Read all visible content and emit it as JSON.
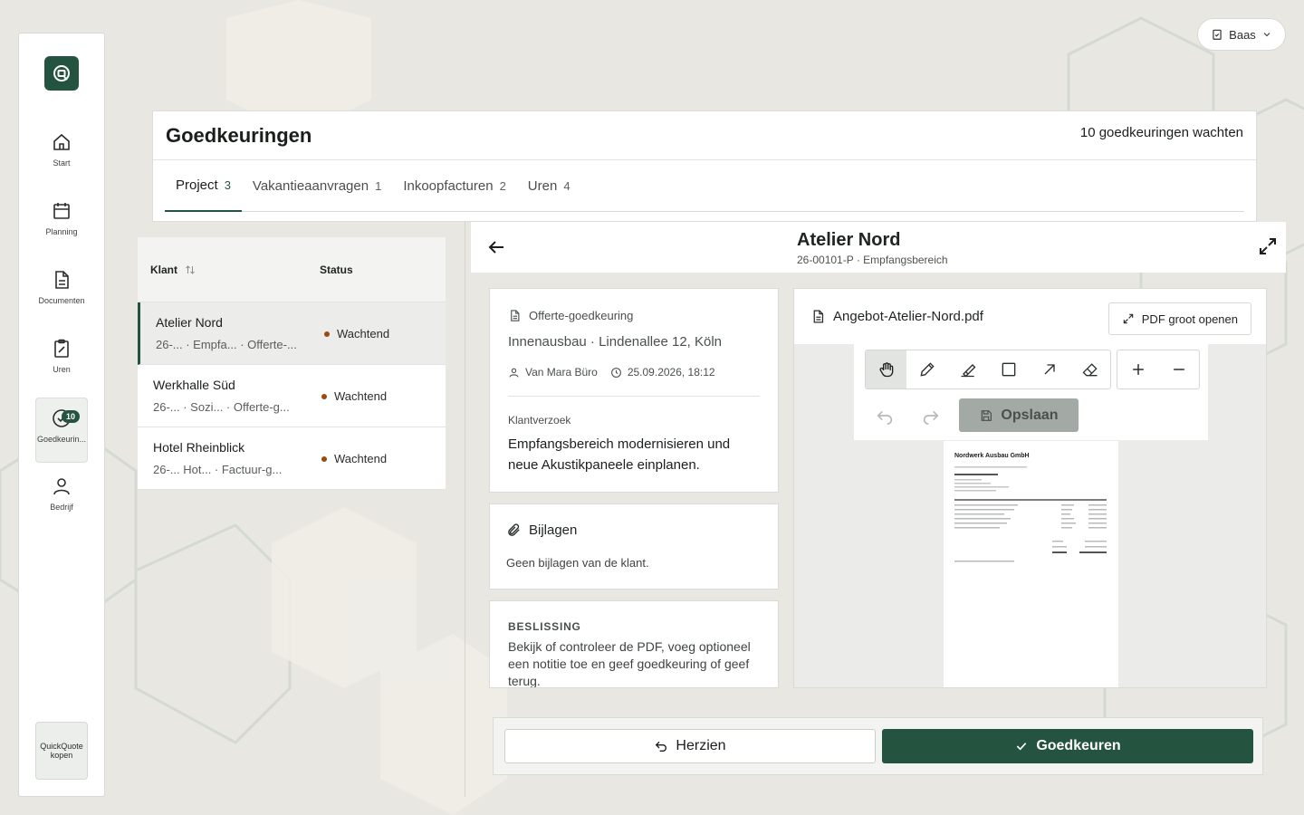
{
  "sidebar": {
    "items": [
      {
        "label": "Start"
      },
      {
        "label": "Planning"
      },
      {
        "label": "Documenten"
      },
      {
        "label": "Uren"
      },
      {
        "label": "Goedkeurin...",
        "badge": "10"
      },
      {
        "label": "Bedrijf"
      }
    ],
    "buy_label": "QuickQuote kopen"
  },
  "role": {
    "label": "Baas"
  },
  "header": {
    "title": "Goedkeuringen",
    "count": "10 goedkeuringen wachten",
    "tabs": [
      {
        "label": "Project",
        "count": "3"
      },
      {
        "label": "Vakantieaanvragen",
        "count": "1"
      },
      {
        "label": "Inkoopfacturen",
        "count": "2"
      },
      {
        "label": "Uren",
        "count": "4"
      }
    ]
  },
  "list": {
    "col_klant": "Klant",
    "col_status": "Status",
    "rows": [
      {
        "name": "Atelier Nord",
        "meta": "26-... · Empfa... · Offerte-...",
        "status": "Wachtend"
      },
      {
        "name": "Werkhalle Süd",
        "meta": "26-...  · Sozi... · Offerte-g...",
        "status": "Wachtend"
      },
      {
        "name": "Hotel Rheinblick",
        "meta": "26-...  Hot...  · Factuur-g...",
        "status": "Wachtend"
      }
    ]
  },
  "detail": {
    "name": "Atelier Nord",
    "sub": "26-00101-P · Empfangsbereich",
    "request": {
      "type": "Offerte-goedkeuring",
      "title": "Innenausbau · Lindenallee 12, Köln",
      "author": "Van Mara Büro",
      "datetime": "25.09.2026, 18:12",
      "label": "Klantverzoek",
      "text": "Empfangsbereich modernisieren und neue Akustikpaneele einplanen."
    },
    "attachments": {
      "title": "Bijlagen",
      "text": "Geen bijlagen van de klant."
    },
    "decision": {
      "label": "BESLISSING",
      "text": "Bekijk of controleer de PDF, voeg optioneel een notitie toe en geef goedkeuring of geef terug."
    }
  },
  "pdf": {
    "filename": "Angebot-Atelier-Nord.pdf",
    "open_label": "PDF groot openen",
    "save_label": "Opslaan",
    "page_title": "Nordwerk Ausbau GmbH"
  },
  "actions": {
    "review_label": "Herzien",
    "approve_label": "Goedkeuren"
  },
  "colors": {
    "brand": "#24543f",
    "status_pending": "#9a4a12"
  }
}
